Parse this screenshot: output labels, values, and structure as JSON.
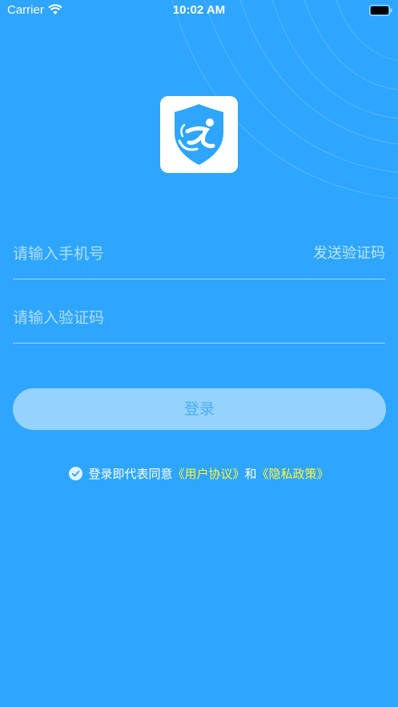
{
  "status_bar": {
    "carrier": "Carrier",
    "time": "10:02 AM",
    "wifi_icon": "wifi-icon",
    "battery_icon": "battery-icon"
  },
  "logo": {
    "icon": "shield-runner-icon"
  },
  "form": {
    "phone_placeholder": "请输入手机号",
    "phone_value": "",
    "send_code_label": "发送验证码",
    "code_placeholder": "请输入验证码",
    "code_value": "",
    "login_label": "登录"
  },
  "agreement": {
    "checked": true,
    "check_icon": "check-circle-icon",
    "prefix": "登录即代表同意",
    "user_agreement": "《用户协议》",
    "joiner": "和",
    "privacy_policy": "《隐私政策》"
  },
  "colors": {
    "background": "#2ea6ff",
    "button": "#94d3fd",
    "button_text": "#4aaef2",
    "link": "#fff23a"
  }
}
